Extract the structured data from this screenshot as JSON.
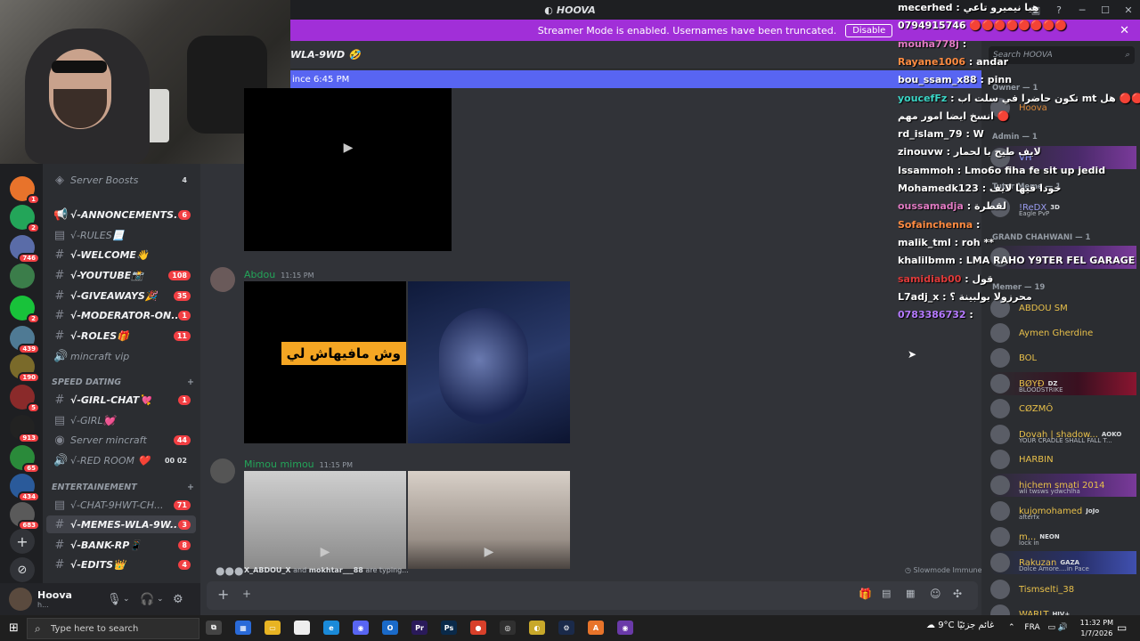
{
  "app": {
    "title": "HOOVA"
  },
  "banner": {
    "text": "Streamer Mode is enabled. Usernames have been truncated.",
    "button": "Disable"
  },
  "channel_header": {
    "title": "WLA-9WD 🤣"
  },
  "new_messages_bar": {
    "text": "ince 6:45 PM"
  },
  "sidebar": {
    "channels": [
      {
        "name": "Server Boosts",
        "count": "4",
        "style": "boost"
      },
      {
        "name": "√-ANNONCEMENTS...",
        "count": "6",
        "style": "announce"
      },
      {
        "name": "√-RULES📃",
        "count": "",
        "style": "dim"
      },
      {
        "name": "√-WELCOME👋",
        "count": "",
        "style": "text"
      },
      {
        "name": "√-YOUTUBE📸",
        "count": "108",
        "style": "text"
      },
      {
        "name": "√-GIVEAWAYS🎉",
        "count": "35",
        "style": "text"
      },
      {
        "name": "√-MODERATOR-ON...",
        "count": "1",
        "style": "text"
      },
      {
        "name": "√-ROLES🎁",
        "count": "11",
        "style": "text"
      },
      {
        "name": "mincraft vip",
        "count": "",
        "style": "voice"
      }
    ],
    "category_speed": "SPEED DATING",
    "speed_channels": [
      {
        "name": "√-GIRL-CHAT💘",
        "count": "1",
        "style": "text"
      },
      {
        "name": "√-GIRL💓",
        "count": "",
        "style": "dim"
      },
      {
        "name": "Server mincraft",
        "count": "44",
        "style": "stage"
      },
      {
        "name": "√-RED ROOM ❤️",
        "count": "00 02",
        "style": "voice"
      }
    ],
    "category_ent": "ENTERTAINEMENT",
    "ent_channels": [
      {
        "name": "√-CHAT-9HWT-CH...",
        "count": "71",
        "style": "dim"
      },
      {
        "name": "√-MEMES-WLA-9W...",
        "count": "3",
        "style": "sel"
      },
      {
        "name": "√-BANK-RP📱",
        "count": "8",
        "style": "text"
      },
      {
        "name": "√-EDITS👑",
        "count": "4",
        "style": "text"
      }
    ]
  },
  "rail": {
    "servers": [
      {
        "badge": "1",
        "color": "#e8732b"
      },
      {
        "badge": "2",
        "color": "#23a559"
      },
      {
        "badge": "746",
        "color": "#5a6ca8"
      },
      {
        "badge": "",
        "color": "#3b7d4a"
      },
      {
        "badge": "2",
        "color": "#18c23a"
      },
      {
        "badge": "439",
        "color": "#4f7a94"
      },
      {
        "badge": "190",
        "color": "#7a6a2a"
      },
      {
        "badge": "5",
        "color": "#8a2a2a"
      },
      {
        "badge": "913",
        "color": "#222222"
      },
      {
        "badge": "65",
        "color": "#2a8a3a"
      },
      {
        "badge": "434",
        "color": "#2a5a9a"
      },
      {
        "badge": "683",
        "color": "#5a5a5a"
      }
    ]
  },
  "user_panel": {
    "name": "Hoova",
    "status": "h..."
  },
  "messages": [
    {
      "author": "Abdou",
      "time": "11:15 PM",
      "overlay_text": "وش مافيهاش لي"
    },
    {
      "author": "Mimou mimou",
      "time": "11:15 PM"
    }
  ],
  "typing": {
    "users": "X_ABDOU_X",
    "and": "and",
    "users2": "mokhtar___88",
    "suffix": "are typing..."
  },
  "slowmode": "Slowmode Immune",
  "stream_chat": [
    {
      "user": "mecerhed",
      "msg": ": هيا نيميرو تاعي",
      "ucolor": "#ffffff"
    },
    {
      "user": "0794915746",
      "msg": "🔴🔴🔴🔴🔴🔴🔴🔴",
      "ucolor": "#ffffff"
    },
    {
      "user": "mouha778j",
      "msg": ":",
      "ucolor": "#e07ac2"
    },
    {
      "user": "Rayane1006",
      "msg": ": andar",
      "ucolor": "#ff8c42"
    },
    {
      "user": "bou_ssam_x88",
      "msg": ": pinn",
      "ucolor": "#ffffff"
    },
    {
      "user": "youcefFz",
      "msg": ": تكون حاضرا في سلت اب mt هل 🔴🔴🔴🔴🔴",
      "ucolor": "#3bd6c6"
    },
    {
      "user": "",
      "msg": "انسخ ايضا امور مهم 🔴",
      "ucolor": "#ffffff"
    },
    {
      "user": "rd_islam_79",
      "msg": ": W",
      "ucolor": "#ffffff"
    },
    {
      "user": "zinouvw",
      "msg": ": لايف طيح با لحمار",
      "ucolor": "#ffffff"
    },
    {
      "user": "Issammoh",
      "msg": ": Lmo6o fiha fe sit up jedid",
      "ucolor": "#ffffff"
    },
    {
      "user": "Mohamedk123",
      "msg": ": خودا فيها لايف",
      "ucolor": "#ffffff"
    },
    {
      "user": "oussamadja",
      "msg": ": لقطرة",
      "ucolor": "#e07ac2"
    },
    {
      "user": "Sofainchenna",
      "msg": ":",
      "ucolor": "#ff8c42"
    },
    {
      "user": "malik_tml",
      "msg": ": roh **",
      "ucolor": "#ffffff"
    },
    {
      "user": "khalilbmm",
      "msg": ": LMA RAHO Y9TER FEL GARAGE",
      "ucolor": "#ffffff"
    },
    {
      "user": "samidiab00",
      "msg": ": قول",
      "ucolor": "#e03a3a"
    },
    {
      "user": "L7adj_x",
      "msg": ": محرزولا بولبينة ؟",
      "ucolor": "#ffffff"
    },
    {
      "user": "0783386732",
      "msg": ":",
      "ucolor": "#b57aff"
    }
  ],
  "search": {
    "placeholder": "Search HOOVA"
  },
  "member_groups": {
    "owner": "Owner — 1",
    "admin": "Admin — 1",
    "meme": "Tutor Meme — 1",
    "grand": "GRAND CHAHWANI — 1",
    "memer": "Memer — 19"
  },
  "members": [
    {
      "name": "Hoova",
      "status": "",
      "color": "#dd8a3a",
      "group": "owner"
    },
    {
      "name": "VH",
      "status": "",
      "color": "#8a9aff",
      "group": "admin"
    },
    {
      "name": "!ReDX",
      "tag": "3D",
      "status": "Eagle PvP",
      "color": "#9a9cf0",
      "group": "meme"
    },
    {
      "name": "ABDOU SM",
      "status": "",
      "color": "#e8c04a"
    },
    {
      "name": "Aymen Gherdine",
      "status": "",
      "color": "#e8c04a"
    },
    {
      "name": "BOL",
      "status": "",
      "color": "#e8c04a"
    },
    {
      "name": "BØYĐ",
      "tag": "DZ",
      "status": "BLOODSTRIKE",
      "color": "#e8c04a"
    },
    {
      "name": "CØZMÔ",
      "status": "",
      "color": "#e8c04a"
    },
    {
      "name": "Dovah | shadow...",
      "tag": "AOKO",
      "status": "YOUR CRADLE SHALL FALL T...",
      "color": "#e8c04a"
    },
    {
      "name": "HARBIN",
      "status": "",
      "color": "#e8c04a"
    },
    {
      "name": "hichem smati 2014",
      "status": "wli twsws ydwchlha",
      "color": "#e8c04a"
    },
    {
      "name": "kujomohamed",
      "tag": "JoJo",
      "status": "afterfx",
      "color": "#e8c04a"
    },
    {
      "name": "m...",
      "tag": "NEON",
      "status": "lock in",
      "color": "#e8c04a"
    },
    {
      "name": "Rakuzan",
      "tag": "GAZA",
      "status": "Dolce Amore....in Pace",
      "color": "#e8c04a"
    },
    {
      "name": "Tismselti_38",
      "status": "",
      "color": "#e8c04a"
    },
    {
      "name": "WARLT",
      "tag": "HIV+",
      "status": "",
      "color": "#e8c04a"
    }
  ],
  "taskbar": {
    "search": "Type here to search",
    "weather": "9°C",
    "weather_text": "غائم جزئيًا",
    "lang": "FRA",
    "time": "11:32 PM",
    "date": "1/7/2026"
  }
}
